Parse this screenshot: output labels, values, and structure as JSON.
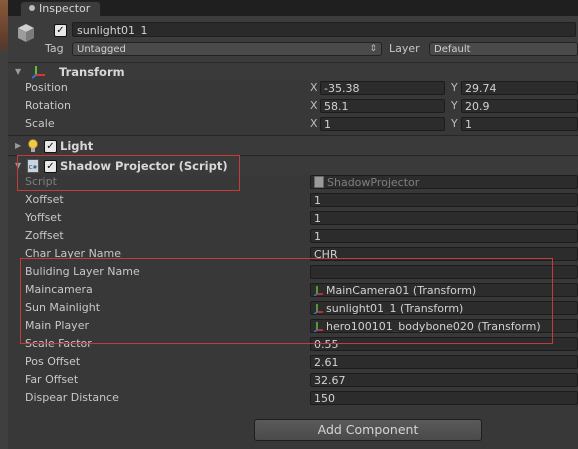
{
  "tab": {
    "title": "Inspector"
  },
  "gameobject": {
    "active": true,
    "name": "sunlight01_1",
    "tag_label": "Tag",
    "tag_value": "Untagged",
    "layer_label": "Layer",
    "layer_value": "Default"
  },
  "transform": {
    "title": "Transform",
    "position": {
      "label": "Position",
      "x_axis": "X",
      "x": "-35.38",
      "y_axis": "Y",
      "y": "29.74"
    },
    "rotation": {
      "label": "Rotation",
      "x_axis": "X",
      "x": "58.1",
      "y_axis": "Y",
      "y": "20.9"
    },
    "scale": {
      "label": "Scale",
      "x_axis": "X",
      "x": "1",
      "y_axis": "Y",
      "y": "1"
    }
  },
  "light": {
    "title": "Light",
    "enabled": true
  },
  "shadow_projector": {
    "title": "Shadow Projector (Script)",
    "enabled": true,
    "fields": [
      {
        "label": "Script",
        "value": "ShadowProjector"
      },
      {
        "label": "Xoffset",
        "value": "1"
      },
      {
        "label": "Yoffset",
        "value": "1"
      },
      {
        "label": "Zoffset",
        "value": "1"
      },
      {
        "label": "Char Layer Name",
        "value": "CHR"
      },
      {
        "label": "Buliding Layer Name",
        "value": ""
      },
      {
        "label": "Maincamera",
        "value": "MainCamera01 (Transform)"
      },
      {
        "label": "Sun Mainlight",
        "value": "sunlight01_1 (Transform)"
      },
      {
        "label": "Main Player",
        "value": "hero100101_bodybone020 (Transform)"
      },
      {
        "label": "Scale Factor",
        "value": "0.55"
      },
      {
        "label": "Pos Offset",
        "value": "2.61"
      },
      {
        "label": "Far Offset",
        "value": "32.67"
      },
      {
        "label": "Dispear Distance",
        "value": "150"
      }
    ]
  },
  "add_component": {
    "label": "Add Component"
  },
  "icons": {
    "tab": "inspector-dot-icon",
    "gameobject": "cube-icon",
    "transform": "transform-axes-icon",
    "light": "lightbulb-icon",
    "script": "script-file-icon",
    "object_ref": "transform-mini-icon"
  },
  "colors": {
    "annotation": "#c43b3b",
    "background": "#383838"
  }
}
